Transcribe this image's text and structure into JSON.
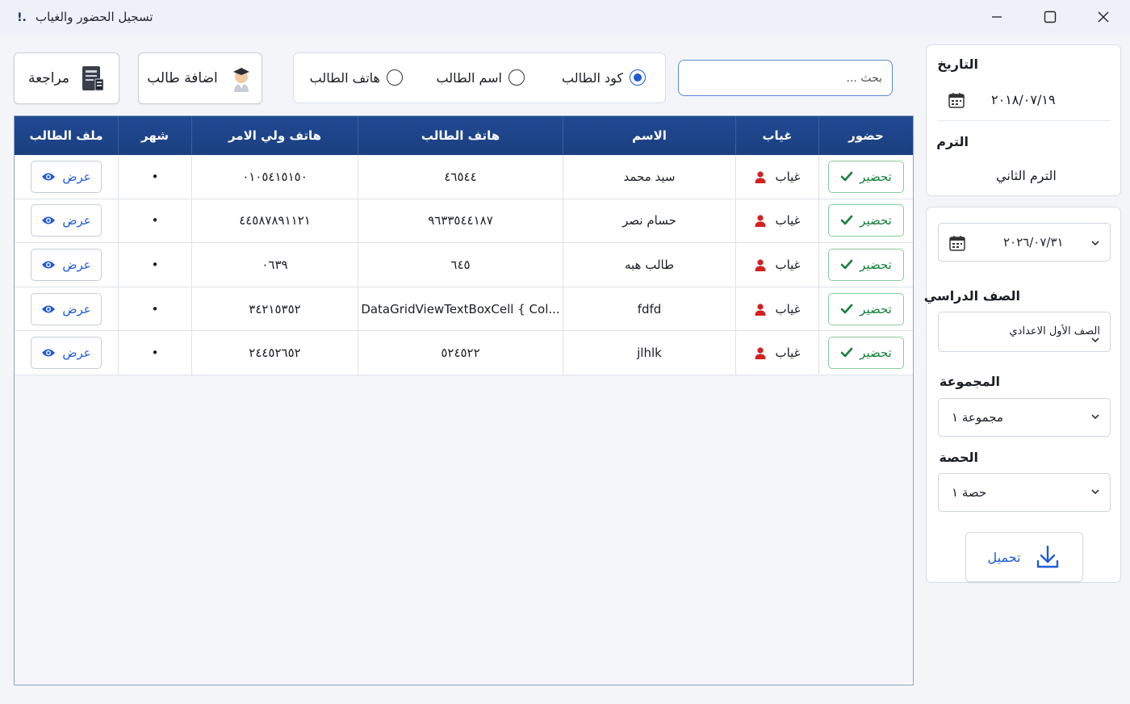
{
  "window": {
    "title": "تسجيل الحضور والغياب",
    "icon_glyph": "!.",
    "controls": [
      "minimize-icon",
      "maximize-icon",
      "close-icon"
    ]
  },
  "toolbar": {
    "review_label": "مراجعة",
    "add_student_label": "اضافة طالب",
    "search_placeholder": "بحث ..."
  },
  "search_mode": {
    "options": [
      {
        "label": "كود الطالب",
        "checked": true
      },
      {
        "label": "اسم الطالب",
        "checked": false
      },
      {
        "label": "هاتف الطالب",
        "checked": false
      }
    ]
  },
  "grid": {
    "columns": [
      "حضور",
      "غياب",
      "الاسم",
      "هاتف الطالب",
      "هاتف ولي الامر",
      "شهر",
      "ملف الطالب"
    ],
    "present_label": "تحضير",
    "absent_label": "غياب",
    "view_label": "عرض",
    "rows": [
      {
        "name": "سيد محمد",
        "student_phone": "٤٦٥٤٤",
        "parent_phone": "٠١٠٥٤١٥١٥٠",
        "month": "•"
      },
      {
        "name": "حسام نصر",
        "student_phone": "٩٦٣٣٥٤٤١٨٧",
        "parent_phone": "٤٤٥٨٧٨٩١١٢١",
        "month": "•"
      },
      {
        "name": "طالب هبه",
        "student_phone": "٦٤٥",
        "parent_phone": "٠٦٣٩",
        "month": "•"
      },
      {
        "name": "fdfd",
        "student_phone": "DataGridViewTextBoxCell { Col...",
        "parent_phone": "٣٤٢١٥٣٥٢",
        "month": "•"
      },
      {
        "name": "jlhlk",
        "student_phone": "٥٢٤٥٢٢",
        "parent_phone": "٢٤٤٥٢٦٥٢",
        "month": "•"
      }
    ]
  },
  "side_panel": {
    "date_label": "التاريخ",
    "date_value": "٢٠١٨/٠٧/١٩",
    "term_label": "الترم",
    "term_value": "الترم الثاني",
    "picker_date": "٢٠٢٦/٠٧/٣١",
    "grade_label": "الصف الدراسي",
    "grade_value": "الصف الأول الاعدادي",
    "group_label": "المجموعة",
    "group_value": "مجموعة ١",
    "session_label": "الحصة",
    "session_value": "حصة ١",
    "load_label": "تحميل"
  },
  "colors": {
    "header_blue": "#1f4589",
    "accent_blue": "#1f5bd6",
    "present_green": "#15803d",
    "absent_red": "#d32020"
  }
}
